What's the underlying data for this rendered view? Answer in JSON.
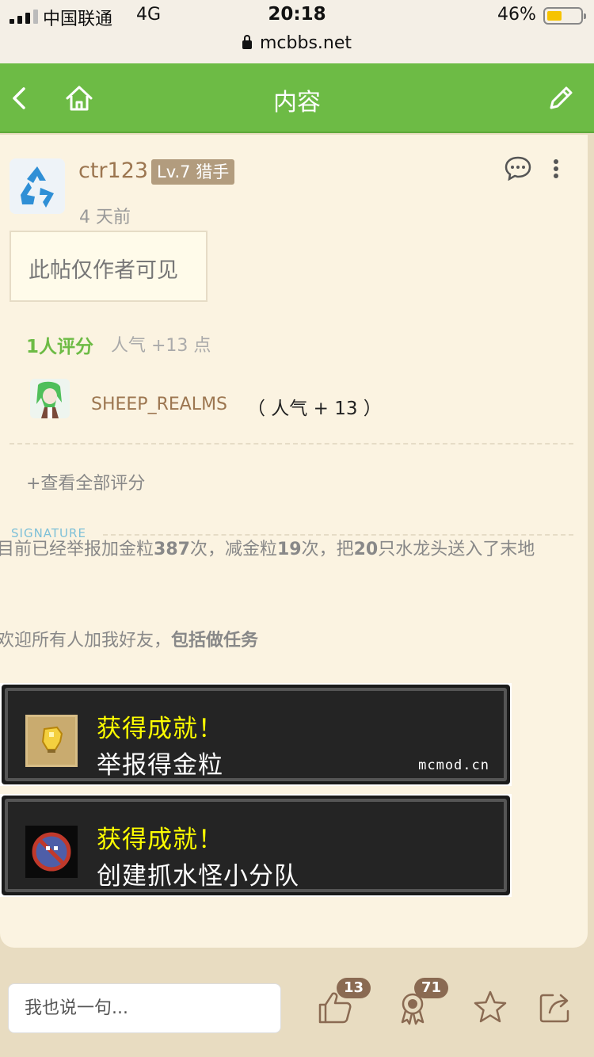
{
  "status_bar": {
    "carrier": "中国联通",
    "network": "4G",
    "time": "20:18",
    "battery_percent": "46%",
    "battery_level": 0.46,
    "url": "mcbbs.net"
  },
  "nav": {
    "title": "内容",
    "back_icon": "chevron-left-icon",
    "home_icon": "home-icon",
    "edit_icon": "pencil-icon"
  },
  "post": {
    "author": "ctr123",
    "level": "Lv.7 猎手",
    "time": "4 天前",
    "hidden_notice": "此帖仅作者可见"
  },
  "rating": {
    "count_label": "1人评分",
    "summary": "人气 +13 点",
    "raters": [
      {
        "name": "SHEEP_REALMS",
        "score": "（ 人气 + 13 ）"
      }
    ],
    "view_all": "+查看全部评分"
  },
  "signature": {
    "label": "SIGNATURE",
    "line1_parts": [
      "目前已经举报加金粒",
      "387",
      "次，减金粒",
      "19",
      "次，把",
      "20",
      "只水龙头送入了末地"
    ],
    "line2_plain": "欢迎所有人加我好友，",
    "line2_bold": "包括做任务"
  },
  "achievements": [
    {
      "title": "获得成就！",
      "desc": "举报得金粒",
      "site": "mcmod.cn",
      "icon": "gold-nugget-icon"
    },
    {
      "title": "获得成就！",
      "desc": "创建抓水怪小分队",
      "site": "",
      "icon": "no-squid-icon"
    }
  ],
  "bottom_bar": {
    "placeholder": "我也说一句...",
    "likes": "13",
    "rewards": "71",
    "colors": {
      "accent": "#6dbb45",
      "badge": "#8a6a52"
    }
  }
}
